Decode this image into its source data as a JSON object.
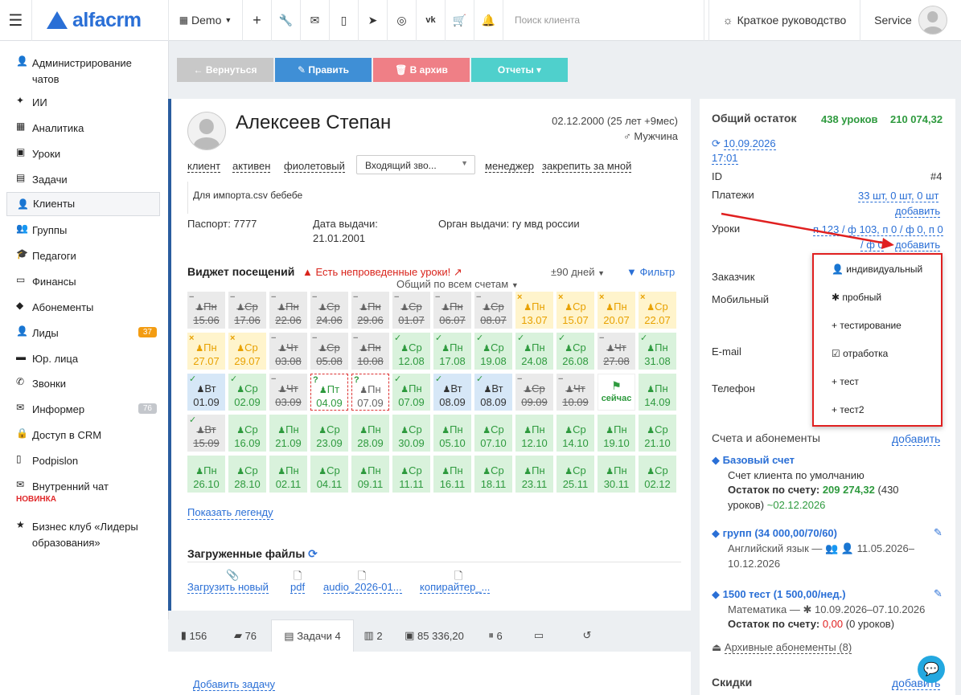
{
  "topbar": {
    "logo": "alfacrm",
    "branch": "Demo",
    "search_placeholder": "Поиск клиента",
    "guide": "Краткое руководство",
    "user": "Service"
  },
  "sidebar": {
    "items": [
      {
        "label": "Администрирование чатов",
        "icon": "user-icon"
      },
      {
        "label": "ИИ",
        "icon": "sparkle-icon"
      },
      {
        "label": "Аналитика",
        "icon": "map-icon"
      },
      {
        "label": "Уроки",
        "icon": "calendar-icon"
      },
      {
        "label": "Задачи",
        "icon": "list-icon"
      },
      {
        "label": "Клиенты",
        "icon": "user-icon"
      },
      {
        "label": "Группы",
        "icon": "users-icon"
      },
      {
        "label": "Педагоги",
        "icon": "graduation-icon"
      },
      {
        "label": "Финансы",
        "icon": "money-icon"
      },
      {
        "label": "Абонементы",
        "icon": "tag-icon"
      },
      {
        "label": "Лиды",
        "icon": "user-plus-icon",
        "badge": "37"
      },
      {
        "label": "Юр. лица",
        "icon": "briefcase-icon"
      },
      {
        "label": "Звонки",
        "icon": "phone-icon"
      },
      {
        "label": "Информер",
        "icon": "envelope-icon",
        "badge": "76"
      },
      {
        "label": "Доступ в CRM",
        "icon": "lock-icon"
      },
      {
        "label": "Podpislon",
        "icon": "file-icon"
      },
      {
        "label": "Внутренний чат",
        "icon": "mail-icon",
        "sub": "НОВИНКА"
      },
      {
        "label": "Бизнес клуб «Лидеры образования»",
        "icon": "star-icon"
      }
    ],
    "badge_colors": {
      "orange": "#f39c12",
      "gray": "#c4c7cc"
    }
  },
  "actions": {
    "back": "← Вернуться",
    "edit": "✎ Править",
    "archive": "🗑 В архив",
    "reports": "Отчеты ▾",
    "colors": {
      "back": "#c8c8c8",
      "edit": "#3f8fd6",
      "archive": "#ef7f86",
      "reports": "#4fd0cc"
    }
  },
  "client": {
    "name": "Алексеев Степан",
    "birth": "02.12.2000 (25 лет +9мес)",
    "gender": "Мужчина",
    "tags": [
      "клиент",
      "активен",
      "фиолетовый"
    ],
    "call_select": "Входящий зво...",
    "manager": "менеджер",
    "pin": "закрепить за мной",
    "note": "Для импорта.csv бебебе",
    "passport_label": "Паспорт:",
    "passport": "7777",
    "issue_label": "Дата выдачи:",
    "issue_date": "21.01.2001",
    "org_label": "Орган выдачи:",
    "org": "гу мвд россии"
  },
  "widget": {
    "title": "Виджет посещений",
    "warning": "Есть непроведенные уроки!",
    "days": "±90 дней",
    "filter": "Фильтр",
    "all_accounts": "Общий по всем счетам",
    "legend": "Показать легенду",
    "cells": [
      {
        "d": "Пн",
        "t": "15.06",
        "s": "gray",
        "m": "−"
      },
      {
        "d": "Ср",
        "t": "17.06",
        "s": "gray",
        "m": "−"
      },
      {
        "d": "Пн",
        "t": "22.06",
        "s": "gray",
        "m": "−"
      },
      {
        "d": "Ср",
        "t": "24.06",
        "s": "gray",
        "m": "−"
      },
      {
        "d": "Пн",
        "t": "29.06",
        "s": "gray",
        "m": "−"
      },
      {
        "d": "Ср",
        "t": "01.07",
        "s": "gray",
        "m": "−"
      },
      {
        "d": "Пн",
        "t": "06.07",
        "s": "gray",
        "m": "−"
      },
      {
        "d": "Ср",
        "t": "08.07",
        "s": "gray",
        "m": "−"
      },
      {
        "d": "Пн",
        "t": "13.07",
        "s": "yellow",
        "m": "×"
      },
      {
        "d": "Ср",
        "t": "15.07",
        "s": "yellow",
        "m": "×"
      },
      {
        "d": "Пн",
        "t": "20.07",
        "s": "yellow",
        "m": "×"
      },
      {
        "d": "Ср",
        "t": "22.07",
        "s": "yellow",
        "m": "×"
      },
      {
        "d": "Пн",
        "t": "27.07",
        "s": "yellow",
        "m": "×"
      },
      {
        "d": "Ср",
        "t": "29.07",
        "s": "yellow",
        "m": "×"
      },
      {
        "d": "Чт",
        "t": "03.08",
        "s": "gray",
        "m": "−"
      },
      {
        "d": "Ср",
        "t": "05.08",
        "s": "gray",
        "m": "−"
      },
      {
        "d": "Пн",
        "t": "10.08",
        "s": "gray",
        "m": "−"
      },
      {
        "d": "Ср",
        "t": "12.08",
        "s": "green",
        "m": "✓"
      },
      {
        "d": "Пн",
        "t": "17.08",
        "s": "green",
        "m": "✓"
      },
      {
        "d": "Ср",
        "t": "19.08",
        "s": "green",
        "m": "✓"
      },
      {
        "d": "Пн",
        "t": "24.08",
        "s": "green",
        "m": "✓"
      },
      {
        "d": "Ср",
        "t": "26.08",
        "s": "green",
        "m": "✓"
      },
      {
        "d": "Чт",
        "t": "27.08",
        "s": "gray",
        "m": "−"
      },
      {
        "d": "Пн",
        "t": "31.08",
        "s": "green",
        "m": "✓"
      },
      {
        "d": "Вт",
        "t": "01.09",
        "s": "blue",
        "m": "✓"
      },
      {
        "d": "Ср",
        "t": "02.09",
        "s": "green",
        "m": "✓"
      },
      {
        "d": "Чт",
        "t": "03.09",
        "s": "gray",
        "m": "−"
      },
      {
        "d": "Пт",
        "t": "04.09",
        "s": "dash",
        "m": "?"
      },
      {
        "d": "Пн",
        "t": "07.09",
        "s": "dashg",
        "m": "?"
      },
      {
        "d": "Пн",
        "t": "07.09",
        "s": "green",
        "m": "✓"
      },
      {
        "d": "Вт",
        "t": "08.09",
        "s": "blue",
        "m": "✓"
      },
      {
        "d": "Вт",
        "t": "08.09",
        "s": "blue",
        "m": "✓"
      },
      {
        "d": "Ср",
        "t": "09.09",
        "s": "gray",
        "m": "−"
      },
      {
        "d": "Чт",
        "t": "10.09",
        "s": "gray",
        "m": "−"
      },
      {
        "d": "",
        "t": "сейчас",
        "s": "now",
        "m": ""
      },
      {
        "d": "Пн",
        "t": "14.09",
        "s": "green",
        "m": ""
      },
      {
        "d": "Вт",
        "t": "15.09",
        "s": "gray",
        "m": "✓"
      },
      {
        "d": "Ср",
        "t": "16.09",
        "s": "green",
        "m": ""
      },
      {
        "d": "Пн",
        "t": "21.09",
        "s": "green",
        "m": ""
      },
      {
        "d": "Ср",
        "t": "23.09",
        "s": "green",
        "m": ""
      },
      {
        "d": "Пн",
        "t": "28.09",
        "s": "green",
        "m": ""
      },
      {
        "d": "Ср",
        "t": "30.09",
        "s": "green",
        "m": ""
      },
      {
        "d": "Пн",
        "t": "05.10",
        "s": "green",
        "m": ""
      },
      {
        "d": "Ср",
        "t": "07.10",
        "s": "green",
        "m": ""
      },
      {
        "d": "Пн",
        "t": "12.10",
        "s": "green",
        "m": ""
      },
      {
        "d": "Ср",
        "t": "14.10",
        "s": "green",
        "m": ""
      },
      {
        "d": "Пн",
        "t": "19.10",
        "s": "green",
        "m": ""
      },
      {
        "d": "Ср",
        "t": "21.10",
        "s": "green",
        "m": ""
      },
      {
        "d": "Пн",
        "t": "26.10",
        "s": "green",
        "m": ""
      },
      {
        "d": "Ср",
        "t": "28.10",
        "s": "green",
        "m": ""
      },
      {
        "d": "Пн",
        "t": "02.11",
        "s": "green",
        "m": ""
      },
      {
        "d": "Ср",
        "t": "04.11",
        "s": "green",
        "m": ""
      },
      {
        "d": "Пн",
        "t": "09.11",
        "s": "green",
        "m": ""
      },
      {
        "d": "Ср",
        "t": "11.11",
        "s": "green",
        "m": ""
      },
      {
        "d": "Пн",
        "t": "16.11",
        "s": "green",
        "m": ""
      },
      {
        "d": "Ср",
        "t": "18.11",
        "s": "green",
        "m": ""
      },
      {
        "d": "Пн",
        "t": "23.11",
        "s": "green",
        "m": ""
      },
      {
        "d": "Ср",
        "t": "25.11",
        "s": "green",
        "m": ""
      },
      {
        "d": "Пн",
        "t": "30.11",
        "s": "green",
        "m": ""
      },
      {
        "d": "Ср",
        "t": "02.12",
        "s": "green",
        "m": ""
      }
    ]
  },
  "files": {
    "title": "Загруженные файлы",
    "upload": "Загрузить новый",
    "items": [
      "pdf",
      "audio_2026-01...",
      "копирайтер_..."
    ]
  },
  "tabs": {
    "items": [
      "156",
      "76",
      "Задачи 4",
      "2",
      "85 336,20",
      "6",
      "",
      ""
    ],
    "add_task": "Добавить задачу"
  },
  "right": {
    "balance_title": "Общий остаток",
    "balance_lessons": "438 уроков",
    "balance_sum": "210 074,32",
    "date": "10.09.2026",
    "time": "17:01",
    "id_label": "ID",
    "id": "#4",
    "payments_label": "Платежи",
    "payments": "33 шт, 0 шт, 0 шт",
    "add": "добавить",
    "lessons_label": "Уроки",
    "lessons_a": "п 123 / ф 103, п 0 / ф 0, п 0",
    "lessons_b": "/ ф 0",
    "customer_label": "Заказчик",
    "mobile_label": "Мобильный",
    "email_label": "E-mail",
    "phone_label": "Телефон",
    "accounts_title": "Счета и абонементы",
    "acc1_title": "Базовый счет",
    "acc1_desc": "Счет клиента по умолчанию",
    "acc1_bal_label": "Остаток по счету:",
    "acc1_bal": "209 274,32",
    "acc1_bal2": "(430",
    "acc1_bal3": "уроков)",
    "acc1_date": "~02.12.2026",
    "acc2_title": "групп (34 000,00/70/60)",
    "acc2_desc": "Английский язык — 👥 👤 11.05.2026–",
    "acc2_desc2": "10.12.2026",
    "acc3_title": "1500 тест (1 500,00/нед.)",
    "acc3_desc": "Математика — ✱ 10.09.2026–07.10.2026",
    "acc3_bal_label": "Остаток по счету:",
    "acc3_bal": "0,00",
    "acc3_bal2": "(0 уроков)",
    "archive": "Архивные абонементы (8)",
    "discounts": "Скидки"
  },
  "popup": {
    "items": [
      {
        "icon": "user-icon",
        "label": "индивидуальный"
      },
      {
        "icon": "asterisk-icon",
        "label": "пробный"
      },
      {
        "icon": "plus-icon",
        "label": "тестирование"
      },
      {
        "icon": "checkbox-icon",
        "label": "отработка"
      },
      {
        "icon": "plus-icon",
        "label": "тест"
      },
      {
        "icon": "plus-icon",
        "label": "тест2"
      }
    ]
  }
}
